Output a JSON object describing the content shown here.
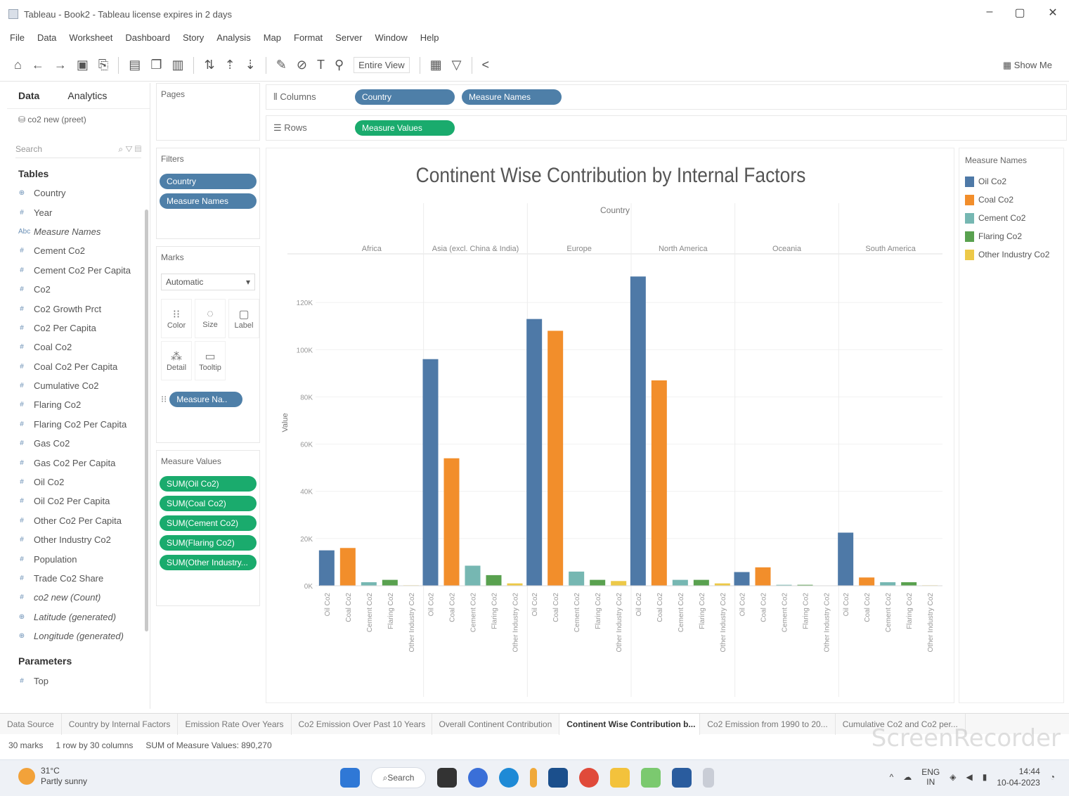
{
  "window": {
    "title": "Tableau - Book2 - Tableau license expires in 2 days",
    "controls": [
      "–",
      "▢",
      "✕"
    ]
  },
  "menu": [
    "File",
    "Data",
    "Worksheet",
    "Dashboard",
    "Story",
    "Analysis",
    "Map",
    "Format",
    "Server",
    "Window",
    "Help"
  ],
  "toolbar": {
    "view_select": "Entire View",
    "show_me": "Show Me"
  },
  "data_pane": {
    "tabs": [
      "Data",
      "Analytics"
    ],
    "datasource": "co2 new (preet)",
    "search_placeholder": "Search",
    "tables_heading": "Tables",
    "fields": [
      {
        "type": "⊕",
        "name": "Country",
        "italic": false
      },
      {
        "type": "#",
        "name": "Year",
        "italic": false
      },
      {
        "type": "Abc",
        "name": "Measure Names",
        "italic": true
      },
      {
        "type": "#",
        "name": "Cement Co2",
        "italic": false
      },
      {
        "type": "#",
        "name": "Cement Co2 Per Capita",
        "italic": false
      },
      {
        "type": "#",
        "name": "Co2",
        "italic": false
      },
      {
        "type": "#",
        "name": "Co2 Growth Prct",
        "italic": false
      },
      {
        "type": "#",
        "name": "Co2 Per Capita",
        "italic": false
      },
      {
        "type": "#",
        "name": "Coal Co2",
        "italic": false
      },
      {
        "type": "#",
        "name": "Coal Co2 Per Capita",
        "italic": false
      },
      {
        "type": "#",
        "name": "Cumulative Co2",
        "italic": false
      },
      {
        "type": "#",
        "name": "Flaring Co2",
        "italic": false
      },
      {
        "type": "#",
        "name": "Flaring Co2 Per Capita",
        "italic": false
      },
      {
        "type": "#",
        "name": "Gas Co2",
        "italic": false
      },
      {
        "type": "#",
        "name": "Gas Co2 Per Capita",
        "italic": false
      },
      {
        "type": "#",
        "name": "Oil Co2",
        "italic": false
      },
      {
        "type": "#",
        "name": "Oil Co2 Per Capita",
        "italic": false
      },
      {
        "type": "#",
        "name": "Other Co2 Per Capita",
        "italic": false
      },
      {
        "type": "#",
        "name": "Other Industry Co2",
        "italic": false
      },
      {
        "type": "#",
        "name": "Population",
        "italic": false
      },
      {
        "type": "#",
        "name": "Trade Co2 Share",
        "italic": false
      },
      {
        "type": "#",
        "name": "co2 new (Count)",
        "italic": true
      },
      {
        "type": "⊕",
        "name": "Latitude (generated)",
        "italic": true
      },
      {
        "type": "⊕",
        "name": "Longitude (generated)",
        "italic": true
      }
    ],
    "parameters_heading": "Parameters",
    "parameters": [
      {
        "type": "#",
        "name": "Top"
      }
    ]
  },
  "cards": {
    "pages_title": "Pages",
    "filters_title": "Filters",
    "filters": [
      "Country",
      "Measure Names"
    ],
    "marks_title": "Marks",
    "marks_type": "Automatic",
    "mark_buttons": [
      {
        "icon": "⁝⁝",
        "label": "Color"
      },
      {
        "icon": "◌",
        "label": "Size"
      },
      {
        "icon": "▢",
        "label": "Label"
      },
      {
        "icon": "⁂",
        "label": "Detail"
      },
      {
        "icon": "▭",
        "label": "Tooltip"
      }
    ],
    "marks_pill": "Measure Na..",
    "measure_values_title": "Measure Values",
    "measure_values": [
      "SUM(Oil Co2)",
      "SUM(Coal Co2)",
      "SUM(Cement Co2)",
      "SUM(Flaring Co2)",
      "SUM(Other Industry..."
    ]
  },
  "shelves": {
    "columns_label": "Columns",
    "columns_pills": [
      "Country",
      "Measure Names"
    ],
    "rows_label": "Rows",
    "rows_pills": [
      "Measure Values"
    ]
  },
  "legend": {
    "title": "Measure Names",
    "items": [
      {
        "label": "Oil Co2",
        "color": "#4e79a7"
      },
      {
        "label": "Coal Co2",
        "color": "#f28e2b"
      },
      {
        "label": "Cement Co2",
        "color": "#76b7b2"
      },
      {
        "label": "Flaring Co2",
        "color": "#59a14f"
      },
      {
        "label": "Other Industry Co2",
        "color": "#edc948"
      }
    ]
  },
  "chart_data": {
    "type": "bar",
    "title": "Continent Wise Contribution by Internal Factors",
    "header_label": "Country",
    "ylabel": "Value",
    "ylim": [
      0,
      140000
    ],
    "yticks": [
      0,
      20000,
      40000,
      60000,
      80000,
      100000,
      120000
    ],
    "ytick_labels": [
      "0K",
      "20K",
      "40K",
      "60K",
      "80K",
      "100K",
      "120K"
    ],
    "groups": [
      "Africa",
      "Asia (excl. China & India)",
      "Europe",
      "North America",
      "Oceania",
      "South America"
    ],
    "categories": [
      "Oil Co2",
      "Coal Co2",
      "Cement Co2",
      "Flaring Co2",
      "Other Industry Co2"
    ],
    "colors": [
      "#4e79a7",
      "#f28e2b",
      "#76b7b2",
      "#59a14f",
      "#edc948"
    ],
    "values": [
      [
        15000,
        16000,
        1500,
        2500,
        200
      ],
      [
        96000,
        54000,
        8500,
        4500,
        1000
      ],
      [
        113000,
        108000,
        6000,
        2500,
        2000
      ],
      [
        131000,
        87000,
        2500,
        2500,
        1000
      ],
      [
        5800,
        7800,
        400,
        400,
        100
      ],
      [
        22500,
        3500,
        1500,
        1500,
        200
      ]
    ]
  },
  "sheet_tabs": [
    {
      "label": "Data Source",
      "active": false
    },
    {
      "label": "Country by Internal Factors",
      "active": false
    },
    {
      "label": "Emission Rate Over Years",
      "active": false
    },
    {
      "label": "Co2 Emission Over Past 10 Years",
      "active": false
    },
    {
      "label": "Overall Continent Contribution",
      "active": false
    },
    {
      "label": "Continent Wise Contribution b...",
      "active": true
    },
    {
      "label": "Co2 Emission from 1990 to 20...",
      "active": false
    },
    {
      "label": "Cumulative Co2 and Co2 per...",
      "active": false
    }
  ],
  "status": {
    "marks": "30 marks",
    "dims": "1 row by 30 columns",
    "sum": "SUM of Measure Values: 890,270"
  },
  "watermark": "ScreenRecorder",
  "taskbar": {
    "weather_temp": "31°C",
    "weather_desc": "Partly sunny",
    "search": "Search",
    "lang_top": "ENG",
    "lang_bottom": "IN",
    "time": "14:44",
    "date": "10-04-2023"
  }
}
